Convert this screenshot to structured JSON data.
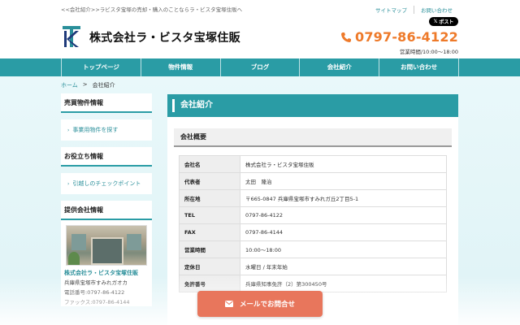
{
  "header": {
    "tagline": "<<会社紹介>>ラビスタ宝塚の売却・購入のことならラ・ビスタ宝塚住販へ",
    "top_links": [
      "サイトマップ",
      "お問い合わせ"
    ],
    "x_post_label": "ポスト",
    "company_name": "株式会社ラ・ビスタ宝塚住販",
    "phone": "0797-86-4122",
    "hours": "営業時間/10:00～18:00"
  },
  "nav": [
    "トップページ",
    "物件情報",
    "ブログ",
    "会社紹介",
    "お問い合わせ"
  ],
  "breadcrumb": {
    "home": "ホーム",
    "sep": ">",
    "current": "会社紹介"
  },
  "sidebar": {
    "sections": [
      {
        "title": "売買物件情報",
        "link": "事業用物件を探す"
      },
      {
        "title": "お役立ち情報",
        "link": "引越しのチェックポイント"
      }
    ],
    "provider": {
      "title": "提供会社情報",
      "name": "株式会社ラ・ビスタ宝塚住販",
      "address": "兵庫県宝塚市すみれガオカ",
      "tel": "電話番号:0797-86-4122",
      "fax": "ファックス:0797-86-4144"
    }
  },
  "main": {
    "title": "会社紹介",
    "section": "会社概要",
    "rows": [
      {
        "k": "会社名",
        "v": "株式会社ラ・ビスタ宝塚住販"
      },
      {
        "k": "代表者",
        "v": "太田　隆治"
      },
      {
        "k": "所在地",
        "v": "〒665-0847 兵庫県宝塚市すみれガ丘2丁目5-1"
      },
      {
        "k": "TEL",
        "v": "0797-86-4122"
      },
      {
        "k": "FAX",
        "v": "0797-86-4144"
      },
      {
        "k": "営業時間",
        "v": "10:00～18:00"
      },
      {
        "k": "定休日",
        "v": "水曜日 / 年末年始"
      },
      {
        "k": "免許番号",
        "v": "兵庫県知事免許（2）第300450号"
      }
    ]
  },
  "cta": {
    "label": "メールでお問合せ"
  },
  "colors": {
    "teal": "#2a9ca5",
    "orange": "#ee7a2a",
    "cta": "#e8765c"
  }
}
